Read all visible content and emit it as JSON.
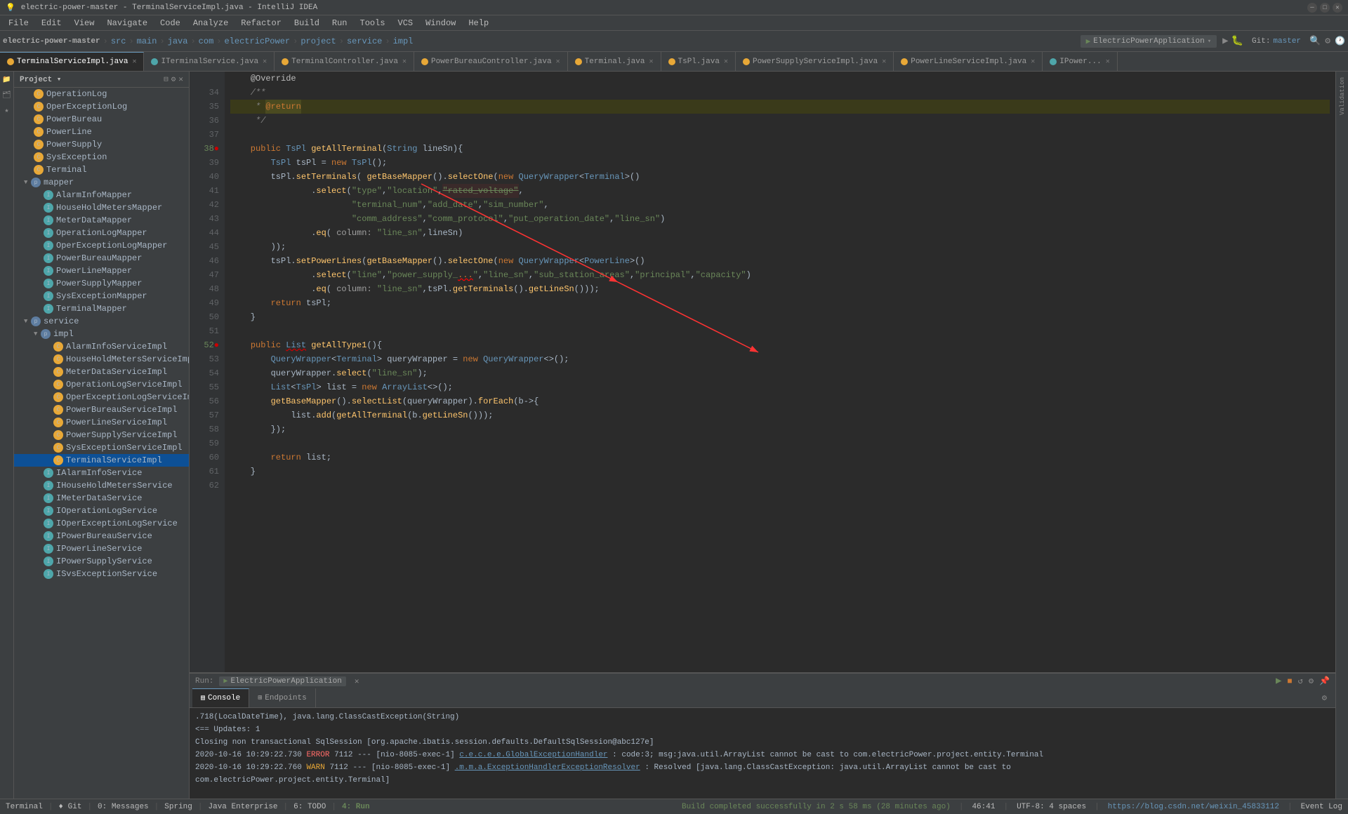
{
  "titleBar": {
    "title": "electric-power-master - TerminalServiceImpl.java - IntelliJ IDEA",
    "buttons": [
      "minimize",
      "maximize",
      "close"
    ]
  },
  "menuBar": {
    "items": [
      "File",
      "Edit",
      "View",
      "Navigate",
      "Code",
      "Analyze",
      "Refactor",
      "Build",
      "Run",
      "Tools",
      "VCS",
      "Window",
      "Help"
    ]
  },
  "toolbar": {
    "projectLabel": "electric-power-master",
    "breadcrumb": [
      "src",
      "main",
      "java",
      "com",
      "electricPower",
      "project",
      "service",
      "impl"
    ],
    "runConfig": "ElectricPowerApplication"
  },
  "tabs": [
    {
      "name": "TerminalServiceImpl.java",
      "active": true,
      "iconColor": "orange"
    },
    {
      "name": "ITerminalService.java",
      "active": false,
      "iconColor": "teal"
    },
    {
      "name": "TerminalController.java",
      "active": false,
      "iconColor": "orange"
    },
    {
      "name": "PowerBureauController.java",
      "active": false,
      "iconColor": "orange"
    },
    {
      "name": "Terminal.java",
      "active": false,
      "iconColor": "orange"
    },
    {
      "name": "TsPl.java",
      "active": false,
      "iconColor": "orange"
    },
    {
      "name": "PowerSupplyServiceImpl.java",
      "active": false,
      "iconColor": "orange"
    },
    {
      "name": "PowerLineServiceImpl.java",
      "active": false,
      "iconColor": "orange"
    },
    {
      "name": "IPower...",
      "active": false,
      "iconColor": "teal"
    }
  ],
  "sidebar": {
    "title": "Project",
    "items": [
      {
        "label": "OperationLog",
        "indent": 2,
        "type": "class",
        "color": "orange"
      },
      {
        "label": "OperExceptionLog",
        "indent": 2,
        "type": "class",
        "color": "orange"
      },
      {
        "label": "PowerBureau",
        "indent": 2,
        "type": "class",
        "color": "orange"
      },
      {
        "label": "PowerLine",
        "indent": 2,
        "type": "class",
        "color": "orange"
      },
      {
        "label": "PowerSupply",
        "indent": 2,
        "type": "class",
        "color": "orange"
      },
      {
        "label": "SysException",
        "indent": 2,
        "type": "class",
        "color": "orange"
      },
      {
        "label": "Terminal",
        "indent": 2,
        "type": "class",
        "color": "orange"
      },
      {
        "label": "mapper",
        "indent": 1,
        "type": "package",
        "color": "package",
        "expanded": true
      },
      {
        "label": "AlarmInfoMapper",
        "indent": 3,
        "type": "interface",
        "color": "teal"
      },
      {
        "label": "HouseHoldMetersMapper",
        "indent": 3,
        "type": "interface",
        "color": "teal"
      },
      {
        "label": "MeterDataMapper",
        "indent": 3,
        "type": "interface",
        "color": "teal"
      },
      {
        "label": "OperationLogMapper",
        "indent": 3,
        "type": "interface",
        "color": "teal"
      },
      {
        "label": "OperExceptionLogMapper",
        "indent": 3,
        "type": "interface",
        "color": "teal"
      },
      {
        "label": "PowerBureauMapper",
        "indent": 3,
        "type": "interface",
        "color": "teal"
      },
      {
        "label": "PowerLineMapper",
        "indent": 3,
        "type": "interface",
        "color": "teal"
      },
      {
        "label": "PowerSupplyMapper",
        "indent": 3,
        "type": "interface",
        "color": "teal"
      },
      {
        "label": "SysExceptionMapper",
        "indent": 3,
        "type": "interface",
        "color": "teal"
      },
      {
        "label": "TerminalMapper",
        "indent": 3,
        "type": "interface",
        "color": "teal"
      },
      {
        "label": "service",
        "indent": 1,
        "type": "package",
        "color": "package",
        "expanded": true
      },
      {
        "label": "impl",
        "indent": 2,
        "type": "package",
        "color": "package",
        "expanded": true
      },
      {
        "label": "AlarmInfoServiceImpl",
        "indent": 4,
        "type": "class",
        "color": "orange"
      },
      {
        "label": "HouseHoldMetersServiceImpl",
        "indent": 4,
        "type": "class",
        "color": "orange"
      },
      {
        "label": "MeterDataServiceImpl",
        "indent": 4,
        "type": "class",
        "color": "orange"
      },
      {
        "label": "OperationLogServiceImpl",
        "indent": 4,
        "type": "class",
        "color": "orange"
      },
      {
        "label": "OperExceptionLogServiceImpl",
        "indent": 4,
        "type": "class",
        "color": "orange"
      },
      {
        "label": "PowerBureauServiceImpl",
        "indent": 4,
        "type": "class",
        "color": "orange"
      },
      {
        "label": "PowerLineServiceImpl",
        "indent": 4,
        "type": "class",
        "color": "orange"
      },
      {
        "label": "PowerSupplyServiceImpl",
        "indent": 4,
        "type": "class",
        "color": "orange"
      },
      {
        "label": "SysExceptionServiceImpl",
        "indent": 4,
        "type": "class",
        "color": "orange"
      },
      {
        "label": "TerminalServiceImpl",
        "indent": 4,
        "type": "class",
        "color": "orange",
        "selected": true
      },
      {
        "label": "IAlarmInfoService",
        "indent": 3,
        "type": "interface",
        "color": "teal"
      },
      {
        "label": "IHouseHoldMetersService",
        "indent": 3,
        "type": "interface",
        "color": "teal"
      },
      {
        "label": "IMeterDataService",
        "indent": 3,
        "type": "interface",
        "color": "teal"
      },
      {
        "label": "IOperationLogService",
        "indent": 3,
        "type": "interface",
        "color": "teal"
      },
      {
        "label": "IOperExceptionLogService",
        "indent": 3,
        "type": "interface",
        "color": "teal"
      },
      {
        "label": "IPowerBureauService",
        "indent": 3,
        "type": "interface",
        "color": "teal"
      },
      {
        "label": "IPowerLineService",
        "indent": 3,
        "type": "interface",
        "color": "teal"
      },
      {
        "label": "IPowerSupplyService",
        "indent": 3,
        "type": "interface",
        "color": "teal"
      },
      {
        "label": "ISvsExceptionService",
        "indent": 3,
        "type": "interface",
        "color": "teal"
      }
    ]
  },
  "codeLines": [
    {
      "num": "",
      "content": "    @Override"
    },
    {
      "num": "34",
      "content": "    /**"
    },
    {
      "num": "35",
      "content": "     * @return"
    },
    {
      "num": "36",
      "content": "     */"
    },
    {
      "num": "37",
      "content": ""
    },
    {
      "num": "38",
      "content": "    public TsPl getAllTerminal(String lineSn){"
    },
    {
      "num": "39",
      "content": "        TsPl tsPl = new TsPl();"
    },
    {
      "num": "40",
      "content": "        tsPl.setTerminals( getBaseMapper().selectOne(new QueryWrapper<Terminal>()"
    },
    {
      "num": "41",
      "content": "                .select(\"type\",\"location\",\"rated_voltage\","
    },
    {
      "num": "42",
      "content": "                        \"terminal_num\",\"add_date\",\"sim_number\","
    },
    {
      "num": "43",
      "content": "                        \"comm_address\",\"comm_protocol\",\"put_operation_date\",\"line_sn\")"
    },
    {
      "num": "44",
      "content": "                .eq( column: \"line_sn\",lineSn)"
    },
    {
      "num": "45",
      "content": "        ));"
    },
    {
      "num": "46",
      "content": "        tsPl.setPowerLines(getBaseMapper().selectOne(new QueryWrapper<PowerLine>()"
    },
    {
      "num": "47",
      "content": "                .select(\"line\",\"power_supply_\",\"line_sn\",\"sub_station_areas\",\"principal\",\"capacity\")"
    },
    {
      "num": "48",
      "content": "                .eq( column: \"line_sn\",tsPl.getTerminals().getLineSn()));"
    },
    {
      "num": "49",
      "content": "        return tsPl;"
    },
    {
      "num": "50",
      "content": "    }"
    },
    {
      "num": "51",
      "content": ""
    },
    {
      "num": "52",
      "content": "    public List getAllType1(){"
    },
    {
      "num": "53",
      "content": "        QueryWrapper<Terminal> queryWrapper = new QueryWrapper<>();"
    },
    {
      "num": "54",
      "content": "        queryWrapper.select(\"line_sn\");"
    },
    {
      "num": "55",
      "content": "        List<TsPl> list = new ArrayList<>();"
    },
    {
      "num": "56",
      "content": "        getBaseMapper().selectList(queryWrapper).forEach(b->{"
    },
    {
      "num": "57",
      "content": "            list.add(getAllTerminal(b.getLineSn()));"
    },
    {
      "num": "58",
      "content": "        });"
    },
    {
      "num": "59",
      "content": ""
    },
    {
      "num": "60",
      "content": "        return list;"
    },
    {
      "num": "61",
      "content": "    }"
    },
    {
      "num": "62",
      "content": ""
    }
  ],
  "runBar": {
    "runLabel": "Run:",
    "appName": "ElectricPowerApplication",
    "closeLabel": "×",
    "tabs": [
      {
        "label": "Console",
        "active": true,
        "icon": "console"
      },
      {
        "label": "Endpoints",
        "active": false,
        "icon": "endpoints"
      }
    ]
  },
  "consoleLogs": [
    {
      "type": "info",
      "text": "    .718(LocalDateTime), java.lang.ClassCastException(String)"
    },
    {
      "type": "info",
      "text": "<==  Updates: 1"
    },
    {
      "type": "info",
      "text": "Closing non transactional SqlSession [org.apache.ibatis.session.defaults.DefaultSqlSession@abc127e]"
    },
    {
      "type": "error",
      "text": "2020-10-16 10:29:22.730 ERROR 7112 --- [nio-8085-exec-1] ",
      "link": "c.e.c.e.e.GlobalExceptionHandler",
      "suffix": "      : code:3; msg:java.util.ArrayList cannot be cast to com.electricPower.project.entity.Terminal"
    },
    {
      "type": "warn",
      "text": "2020-10-16 10:29:22.760 WARN  7112 --- [nio-8085-exec-1] ",
      "link": ".m.m.a.ExceptionHandlerExceptionResolver",
      "suffix": " : Resolved [java.lang.ClassCastException: java.util.ArrayList cannot be cast to"
    },
    {
      "type": "info",
      "text": "com.electricPower.project.entity.Terminal]"
    }
  ],
  "statusBar": {
    "leftItems": [
      "Terminal",
      "♦ Git",
      "0: Messages",
      "Spring",
      "Java Enterprise",
      "6: TODO",
      "4: Run"
    ],
    "rightItems": [
      "Build completed successfully in 2 s 58 ms (28 minutes ago)",
      "46:41",
      "UTF-8: 4 spaces",
      "https://blog.csdn.net/weixin_45833112",
      "Event Log"
    ],
    "gitBranch": "master"
  }
}
